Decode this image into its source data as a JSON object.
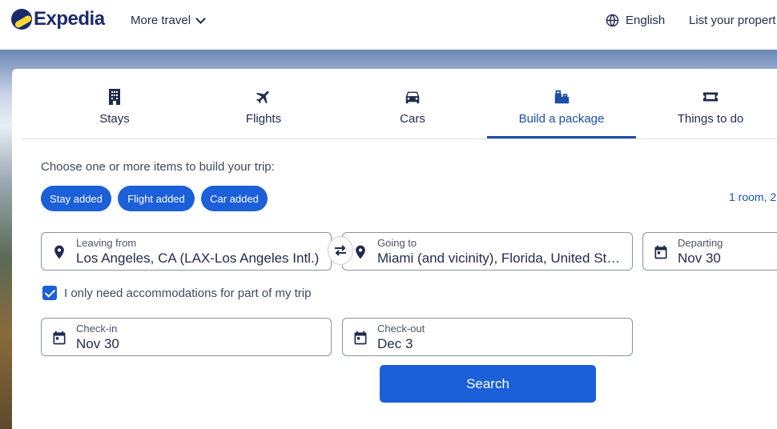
{
  "header": {
    "logo": "Expedia",
    "more_travel": "More travel",
    "language": "English",
    "list_property": "List your propert"
  },
  "tabs": [
    {
      "label": "Stays",
      "icon": "building-icon"
    },
    {
      "label": "Flights",
      "icon": "airplane-icon"
    },
    {
      "label": "Cars",
      "icon": "car-icon"
    },
    {
      "label": "Build a package",
      "icon": "luggage-icon",
      "active": true
    },
    {
      "label": "Things to do",
      "icon": "ticket-icon"
    }
  ],
  "package": {
    "intro": "Choose one or more items to build your trip:",
    "chips": [
      "Stay added",
      "Flight added",
      "Car added"
    ],
    "rooms": "1 room, 2"
  },
  "fields": {
    "leaving": {
      "label": "Leaving from",
      "value": "Los Angeles, CA (LAX-Los Angeles Intl.)"
    },
    "going": {
      "label": "Going to",
      "value": "Miami (and vicinity), Florida, United States of America"
    },
    "departing": {
      "label": "Departing",
      "value": "Nov 30"
    },
    "checkin": {
      "label": "Check-in",
      "value": "Nov 30"
    },
    "checkout": {
      "label": "Check-out",
      "value": "Dec 3"
    }
  },
  "partial_stay": {
    "label": "I only need accommodations for part of my trip",
    "checked": true
  },
  "search_label": "Search",
  "colors": {
    "primary": "#1b5fd9",
    "active_tab": "#1b4fa8",
    "text": "#1f2b4d"
  }
}
